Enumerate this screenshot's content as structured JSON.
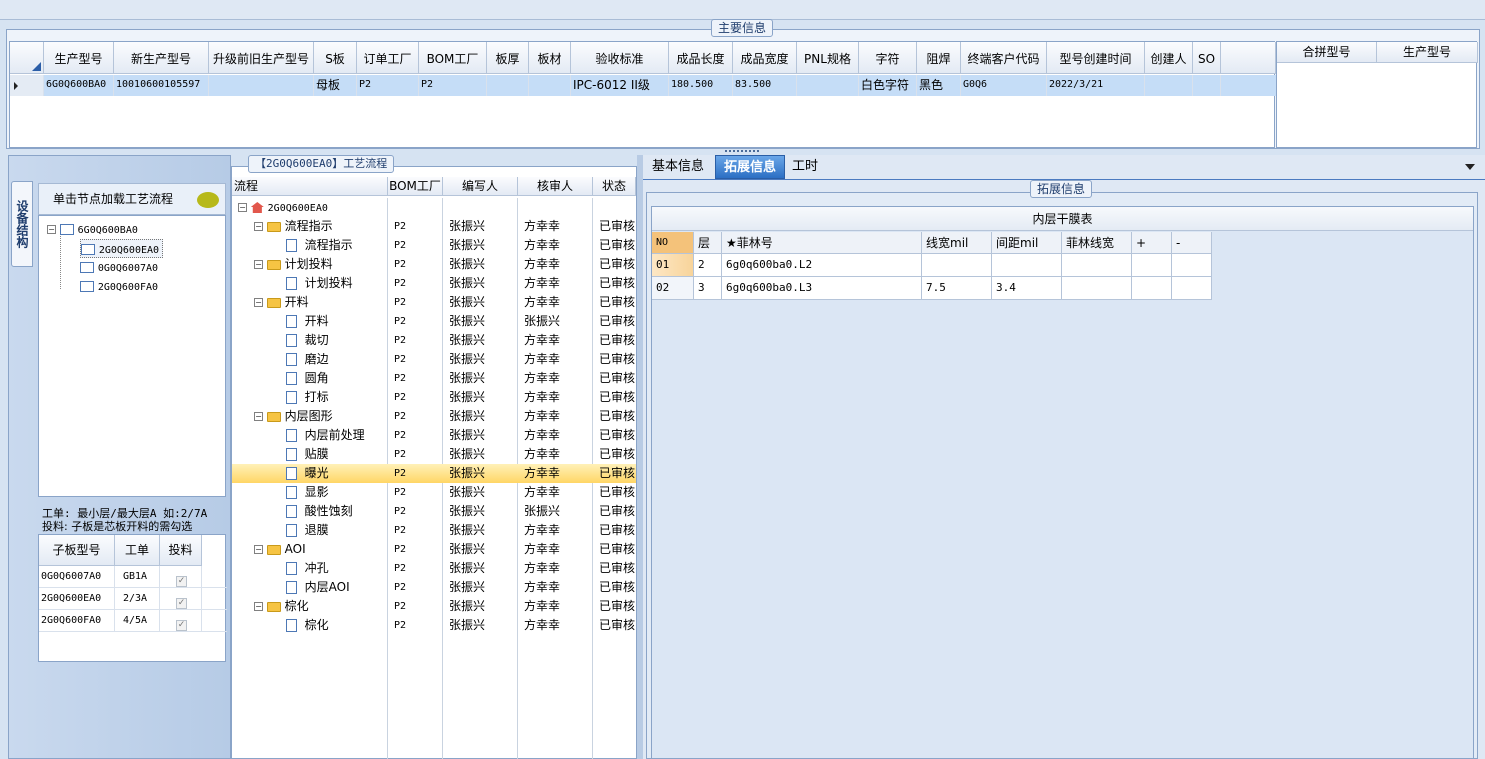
{
  "main_info": {
    "title": "主要信息",
    "columns": [
      "生产型号",
      "新生产型号",
      "升级前旧生产型号",
      "S板",
      "订单工厂",
      "BOM工厂",
      "板厚",
      "板材",
      "验收标准",
      "成品长度",
      "成品宽度",
      "PNL规格",
      "字符",
      "阻焊",
      "终端客户代码",
      "型号创建时间",
      "创建人",
      "SO"
    ],
    "row": [
      "6G0Q600BA0",
      "10010600105597",
      "",
      "母板",
      "P2",
      "P2",
      "",
      "",
      "IPC-6012 II级",
      "180.500",
      "83.500",
      "",
      "白色字符",
      "黑色",
      "G0Q6",
      "2022/3/21",
      "",
      ""
    ]
  },
  "merge": {
    "columns": [
      "合拼型号",
      "生产型号"
    ]
  },
  "left": {
    "side_tab": "设备结构",
    "load_btn": "单击节点加载工艺流程",
    "tree": {
      "root": "6G0Q600BA0",
      "children": [
        "2G0Q600EA0",
        "0G0Q6007A0",
        "2G0Q600FA0"
      ]
    },
    "note1": "工单: 最小层/最大层A 如:2/7A",
    "note2": "投料: 子板是芯板开料的需勾选",
    "sub_columns": [
      "子板型号",
      "工单",
      "投料"
    ],
    "sub_rows": [
      [
        "0G0Q6007A0",
        "GB1A"
      ],
      [
        "2G0Q600EA0",
        "2/3A"
      ],
      [
        "2G0Q600FA0",
        "4/5A"
      ]
    ]
  },
  "flow": {
    "title": "【2G0Q600EA0】工艺流程",
    "columns": [
      "流程",
      "BOM工厂",
      "编写人",
      "核审人",
      "状态"
    ],
    "root": "2G0Q600EA0",
    "rows": [
      {
        "name": "流程指示",
        "type": "folder",
        "bom": "P2",
        "w": "张振兴",
        "r": "方幸幸",
        "s": "已审核"
      },
      {
        "name": "流程指示",
        "type": "doc",
        "bom": "P2",
        "w": "张振兴",
        "r": "方幸幸",
        "s": "已审核"
      },
      {
        "name": "计划投料",
        "type": "folder",
        "bom": "P2",
        "w": "张振兴",
        "r": "方幸幸",
        "s": "已审核"
      },
      {
        "name": "计划投料",
        "type": "doc",
        "bom": "P2",
        "w": "张振兴",
        "r": "方幸幸",
        "s": "已审核"
      },
      {
        "name": "开料",
        "type": "folder",
        "bom": "P2",
        "w": "张振兴",
        "r": "方幸幸",
        "s": "已审核"
      },
      {
        "name": "开料",
        "type": "doc",
        "bom": "P2",
        "w": "张振兴",
        "r": "张振兴",
        "s": "已审核"
      },
      {
        "name": "裁切",
        "type": "doc",
        "bom": "P2",
        "w": "张振兴",
        "r": "方幸幸",
        "s": "已审核"
      },
      {
        "name": "磨边",
        "type": "doc",
        "bom": "P2",
        "w": "张振兴",
        "r": "方幸幸",
        "s": "已审核"
      },
      {
        "name": "圆角",
        "type": "doc",
        "bom": "P2",
        "w": "张振兴",
        "r": "方幸幸",
        "s": "已审核"
      },
      {
        "name": "打标",
        "type": "doc",
        "bom": "P2",
        "w": "张振兴",
        "r": "方幸幸",
        "s": "已审核"
      },
      {
        "name": "内层图形",
        "type": "folder",
        "bom": "P2",
        "w": "张振兴",
        "r": "方幸幸",
        "s": "已审核"
      },
      {
        "name": "内层前处理",
        "type": "doc",
        "bom": "P2",
        "w": "张振兴",
        "r": "方幸幸",
        "s": "已审核"
      },
      {
        "name": "贴膜",
        "type": "doc",
        "bom": "P2",
        "w": "张振兴",
        "r": "方幸幸",
        "s": "已审核"
      },
      {
        "name": "曝光",
        "type": "doc",
        "bom": "P2",
        "w": "张振兴",
        "r": "方幸幸",
        "s": "已审核",
        "selected": true
      },
      {
        "name": "显影",
        "type": "doc",
        "bom": "P2",
        "w": "张振兴",
        "r": "方幸幸",
        "s": "已审核"
      },
      {
        "name": "酸性蚀刻",
        "type": "doc",
        "bom": "P2",
        "w": "张振兴",
        "r": "张振兴",
        "s": "已审核"
      },
      {
        "name": "退膜",
        "type": "doc",
        "bom": "P2",
        "w": "张振兴",
        "r": "方幸幸",
        "s": "已审核"
      },
      {
        "name": "AOI",
        "type": "folder",
        "bom": "P2",
        "w": "张振兴",
        "r": "方幸幸",
        "s": "已审核"
      },
      {
        "name": "冲孔",
        "type": "doc",
        "bom": "P2",
        "w": "张振兴",
        "r": "方幸幸",
        "s": "已审核"
      },
      {
        "name": "内层AOI",
        "type": "doc",
        "bom": "P2",
        "w": "张振兴",
        "r": "方幸幸",
        "s": "已审核"
      },
      {
        "name": "棕化",
        "type": "folder",
        "bom": "P2",
        "w": "张振兴",
        "r": "方幸幸",
        "s": "已审核"
      },
      {
        "name": "棕化",
        "type": "doc",
        "bom": "P2",
        "w": "张振兴",
        "r": "方幸幸",
        "s": "已审核"
      }
    ]
  },
  "right": {
    "tabs": [
      "基本信息",
      "拓展信息",
      "工时"
    ],
    "group_title": "拓展信息",
    "table_title": "内层干膜表",
    "columns": [
      "NO",
      "层",
      "★菲林号",
      "线宽mil",
      "间距mil",
      "菲林线宽",
      "+",
      "-"
    ],
    "rows": [
      [
        "01",
        "2",
        "6g0q600ba0.L2",
        "",
        "",
        "",
        "",
        ""
      ],
      [
        "02",
        "3",
        "6g0q600ba0.L3",
        "7.5",
        "3.4",
        "",
        "",
        ""
      ]
    ]
  }
}
